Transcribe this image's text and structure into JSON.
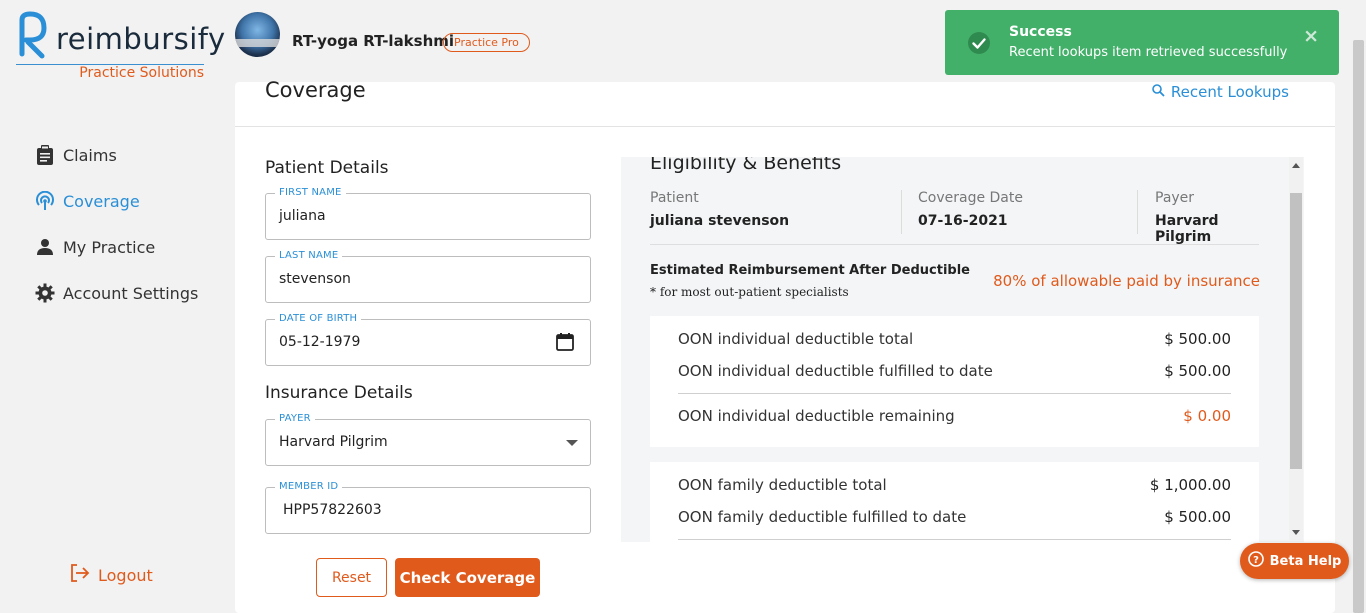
{
  "brand": {
    "name": "reimbursify",
    "subtitle": "Practice Solutions"
  },
  "header": {
    "user_name": "RT-yoga RT-lakshmi",
    "plan_badge": "Practice Pro"
  },
  "sidebar": {
    "items": [
      {
        "label": "Claims",
        "icon": "clipboard-icon"
      },
      {
        "label": "Coverage",
        "icon": "signal-icon",
        "active": true
      },
      {
        "label": "My Practice",
        "icon": "person-icon"
      },
      {
        "label": "Account Settings",
        "icon": "gear-icon"
      }
    ],
    "logout_label": "Logout"
  },
  "main": {
    "title": "Coverage",
    "recent_lookups_label": "Recent Lookups",
    "patient_details_title": "Patient Details",
    "first_name": {
      "label": "FIRST NAME",
      "value": "juliana"
    },
    "last_name": {
      "label": "LAST NAME",
      "value": "stevenson"
    },
    "dob": {
      "label": "DATE OF BIRTH",
      "value": "05-12-1979"
    },
    "insurance_details_title": "Insurance Details",
    "payer": {
      "label": "PAYER",
      "value": "Harvard Pilgrim"
    },
    "member_id": {
      "label": "MEMBER ID",
      "value": "HPP57822603"
    },
    "reset_label": "Reset",
    "check_label": "Check Coverage"
  },
  "results": {
    "title": "Eligibility & Benefits",
    "patient_label": "Patient",
    "patient_value": "juliana stevenson",
    "coverage_date_label": "Coverage Date",
    "coverage_date_value": "07-16-2021",
    "payer_label": "Payer",
    "payer_value": "Harvard Pilgrim",
    "est_title": "Estimated Reimbursement After Deductible",
    "est_note": "* for most out-patient specialists",
    "est_pct": "80% of allowable paid by insurance",
    "individual": {
      "total_label": "OON individual deductible total",
      "total_value": "$ 500.00",
      "fulfilled_label": "OON individual deductible fulfilled to date",
      "fulfilled_value": "$ 500.00",
      "remaining_label": "OON individual deductible remaining",
      "remaining_value": "$ 0.00"
    },
    "family": {
      "total_label": "OON family deductible total",
      "total_value": "$ 1,000.00",
      "fulfilled_label": "OON family deductible fulfilled to date",
      "fulfilled_value": "$ 500.00"
    }
  },
  "toast": {
    "title": "Success",
    "message": "Recent lookups item retrieved successfully",
    "close": "×"
  },
  "beta_help_label": "Beta Help",
  "colors": {
    "accent_orange": "#e05a1c",
    "accent_blue": "#2a8fd6",
    "success_green": "#43b06a"
  }
}
